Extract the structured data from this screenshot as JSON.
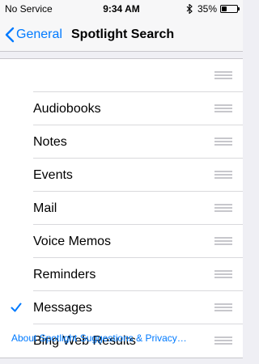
{
  "status_bar": {
    "carrier": "No Service",
    "time": "9:34 AM",
    "battery": "35%",
    "battery_level": 0.35,
    "bluetooth_icon": "bluetooth-icon"
  },
  "nav": {
    "back_label": "General",
    "back_icon": "chevron-left-icon",
    "title": "Spotlight Search"
  },
  "list": {
    "items": [
      {
        "label": "",
        "checked": false
      },
      {
        "label": "Audiobooks",
        "checked": false
      },
      {
        "label": "Notes",
        "checked": false
      },
      {
        "label": "Events",
        "checked": false
      },
      {
        "label": "Mail",
        "checked": false
      },
      {
        "label": "Voice Memos",
        "checked": false
      },
      {
        "label": "Reminders",
        "checked": false
      },
      {
        "label": "Messages",
        "checked": true
      },
      {
        "label": "Bing Web Results",
        "checked": false
      }
    ]
  },
  "footer": {
    "link_label": "About Spotlight Suggestions & Privacy…"
  },
  "colors": {
    "accent": "#007aff",
    "background": "#efeff4",
    "separator": "#c8c7cc"
  }
}
